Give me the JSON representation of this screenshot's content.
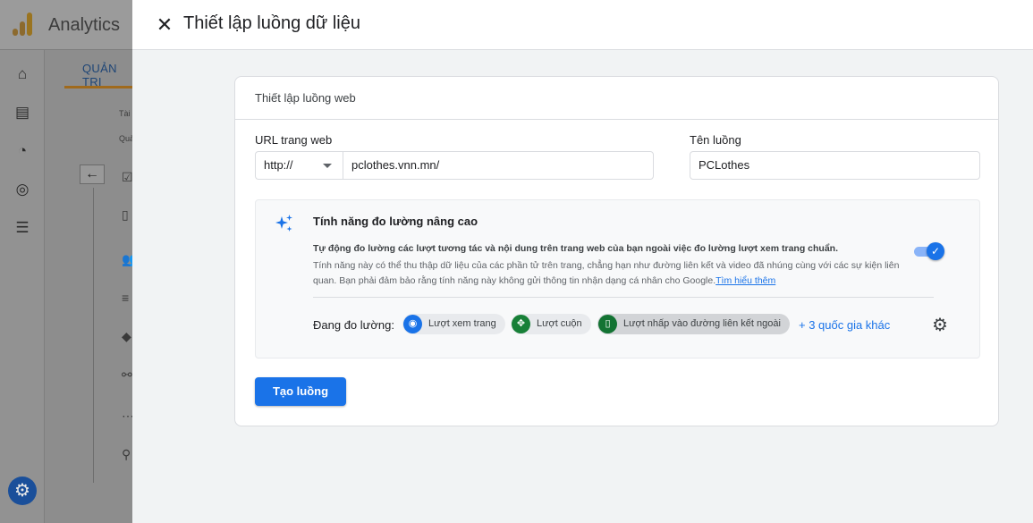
{
  "background": {
    "app_name": "Analytics",
    "tab_label": "QUẢN TRỊ",
    "small_label_1": "Tài",
    "small_label_2": "Quả"
  },
  "sheet": {
    "title": "Thiết lập luồng dữ liệu",
    "card": {
      "title": "Thiết lập luồng web",
      "url_label": "URL trang web",
      "protocol_value": "http://",
      "url_value": "pclothes.vnn.mn/",
      "stream_name_label": "Tên luồng",
      "stream_name_value": "PCLothes",
      "enhanced": {
        "title": "Tính năng đo lường nâng cao",
        "desc_bold": "Tự động đo lường các lượt tương tác và nội dung trên trang web của bạn ngoài việc đo lường lượt xem trang chuẩn.",
        "desc": "Tính năng này có thể thu thập dữ liệu của các phần tử trên trang, chẳng hạn như đường liên kết và video đã nhúng cùng với các sự kiện liên quan. Bạn phải đảm bảo rằng tính năng này không gửi thông tin nhận dạng cá nhân cho Google.",
        "link": "Tìm hiểu thêm",
        "toggle_on": true,
        "measuring_label": "Đang đo lường:",
        "chips": [
          {
            "label": "Lượt xem trang",
            "icon": "eye-icon",
            "color": "#1a73e8"
          },
          {
            "label": "Lượt cuộn",
            "icon": "scroll-icon",
            "color": "#188038"
          },
          {
            "label": "Lượt nhấp vào đường liên kết ngoài",
            "icon": "mouse-icon",
            "color": "#137333"
          }
        ],
        "more_label": "+ 3 quốc gia khác"
      },
      "create_button": "Tạo luồng"
    }
  },
  "colors": {
    "primary": "#1a73e8",
    "analytics_orange": "#f9ab00",
    "analytics_dark_orange": "#e37400"
  }
}
